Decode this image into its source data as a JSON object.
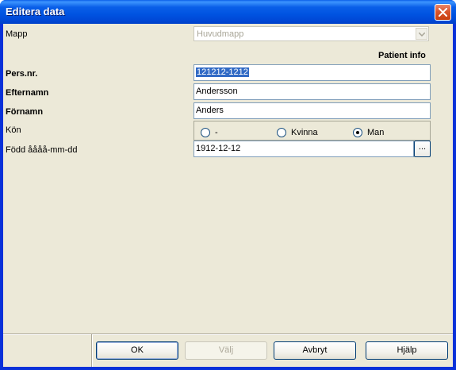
{
  "window": {
    "title": "Editera data"
  },
  "folder": {
    "label": "Mapp",
    "value": "Huvudmapp"
  },
  "section": {
    "heading": "Patient info"
  },
  "fields": {
    "persnr": {
      "label": "Pers.nr.",
      "value": "121212-1212"
    },
    "efternamn": {
      "label": "Efternamn",
      "value": "Andersson"
    },
    "fornamn": {
      "label": "Förnamn",
      "value": "Anders"
    },
    "kon": {
      "label": "Kön",
      "options": [
        "-",
        "Kvinna",
        "Man"
      ],
      "selected": "Man"
    },
    "fodd": {
      "label": "Född åååå-mm-dd",
      "value": "1912-12-12",
      "browse_label": "..."
    }
  },
  "buttons": {
    "ok": "OK",
    "valj": "Välj",
    "avbryt": "Avbryt",
    "hjalp": "Hjälp"
  }
}
